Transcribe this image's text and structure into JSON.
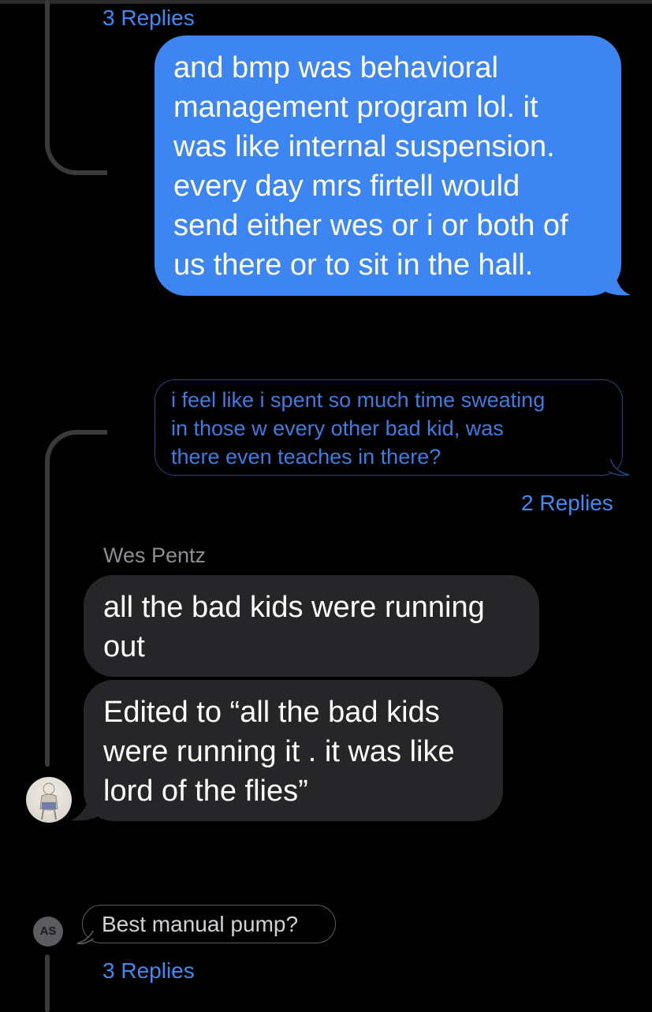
{
  "colors": {
    "background": "#000000",
    "sent_bubble": "#3d86f2",
    "received_bubble": "#262628",
    "link_blue": "#3d8bf5",
    "thread_line": "#3a3a3c"
  },
  "thread_top": {
    "replies_label": "3 Replies"
  },
  "sent_message": {
    "lines": [
      "and bmp was behavioral",
      "management program lol. it",
      "was like internal suspension.",
      "every day mrs firtell would",
      "send either wes or i or both of",
      "us there or to sit in the hall."
    ]
  },
  "quoted_message": {
    "lines": [
      "i feel like i spent so much time sweating",
      "in those w every other bad kid, was",
      "there even teaches in there?"
    ],
    "replies_label": "2 Replies"
  },
  "received": {
    "sender": "Wes Pentz",
    "avatar_icon": "profile-photo-icon",
    "messages": [
      {
        "lines": [
          "all the bad kids were running",
          "out"
        ]
      },
      {
        "lines": [
          "Edited to “all the bad kids",
          "were running it . it was like",
          "lord of the flies”"
        ]
      }
    ]
  },
  "next_thread": {
    "initials": "AS",
    "preview": "Best manual pump?",
    "replies_label": "3 Replies"
  }
}
